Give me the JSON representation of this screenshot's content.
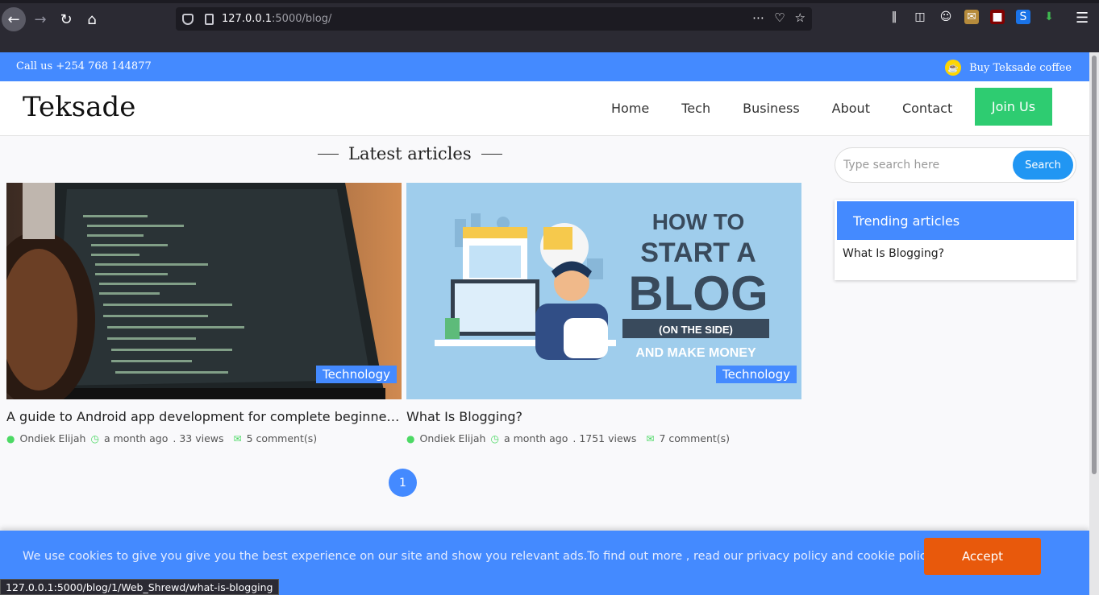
{
  "browser": {
    "url_host": "127.0.0.1",
    "url_path": ":5000/blog/",
    "status_url": "127.0.0.1:5000/blog/1/Web_Shrewd/what-is-blogging"
  },
  "topbar": {
    "call": "Call us +254 768 144877",
    "coffee": "Buy Teksade coffee"
  },
  "header": {
    "brand": "Teksade",
    "nav": [
      "Home",
      "Tech",
      "Business",
      "About",
      "Contact"
    ],
    "join": "Join Us"
  },
  "main": {
    "section_title": "Latest articles",
    "articles": [
      {
        "title": "A guide to Android app development for complete beginners...",
        "category": "Technology",
        "author": "Ondiek Elijah",
        "time": "a month ago",
        "views": ". 33 views",
        "comments": "5 comment(s)"
      },
      {
        "title": "What Is Blogging?",
        "category": "Technology",
        "author": "Ondiek Elijah",
        "time": "a month ago",
        "views": ". 1751 views",
        "comments": "7 comment(s)"
      }
    ],
    "page": "1",
    "blog_image_text": {
      "line1": "HOW TO",
      "line2": "START A",
      "line3": "BLOG",
      "line4": "(ON THE SIDE)",
      "line5": "AND MAKE MONEY"
    }
  },
  "sidebar": {
    "search_placeholder": "Type search here",
    "search_button": "Search",
    "trending_title": "Trending articles",
    "trending_items": [
      "What Is Blogging?"
    ]
  },
  "cookie": {
    "text": "We use cookies to give you give you the best experience on our site and show you relevant ads.To find out more , read our privacy policy and cookie policy",
    "accept": "Accept"
  },
  "colors": {
    "brand_blue": "#448aff",
    "join_green": "#2ecc71",
    "accept_orange": "#e8590c"
  }
}
